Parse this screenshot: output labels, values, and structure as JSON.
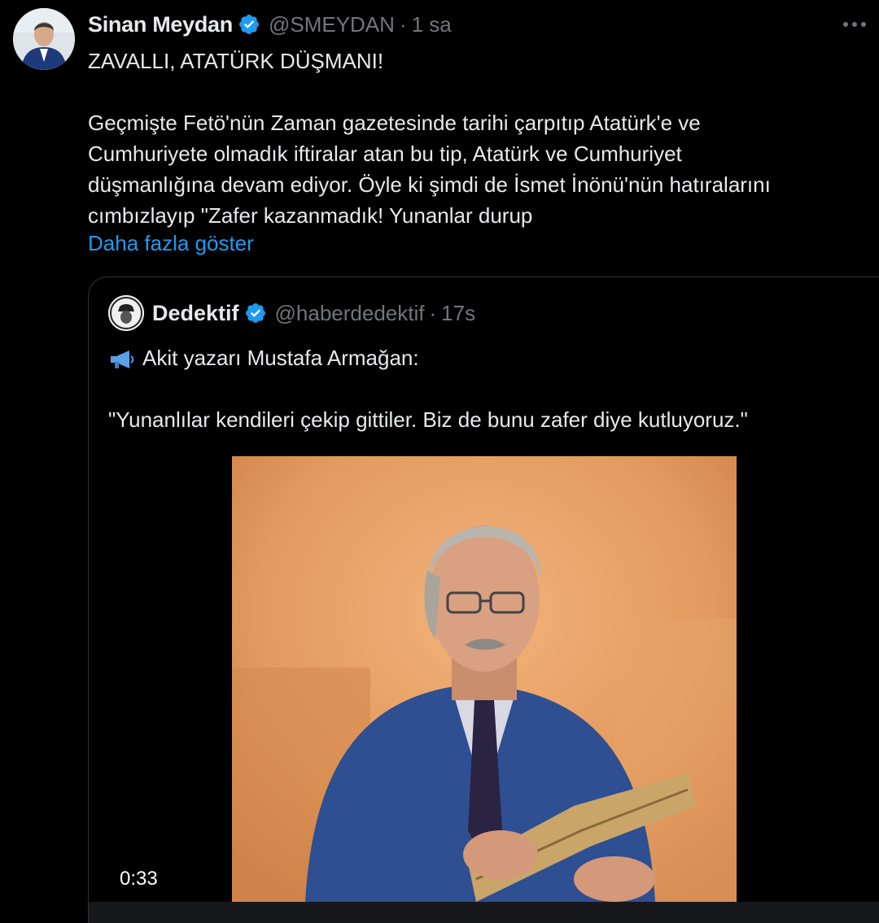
{
  "tweet": {
    "author_name": "Sinan Meydan",
    "handle": "@SMEYDAN",
    "separator": "·",
    "time": "1 sa",
    "title_line": "ZAVALLI, ATATÜRK DÜŞMANI!",
    "body_lines": [
      "Geçmişte Fetö'nün Zaman gazetesinde tarihi çarpıtıp Atatürk'e ve",
      "Cumhuriyete olmadık iftiralar atan bu tip, Atatürk ve Cumhuriyet",
      "düşmanlığına devam ediyor. Öyle ki şimdi de İsmet İnönü'nün hatıralarını",
      "cımbızlayıp \"Zafer kazanmadık! Yunanlar durup"
    ],
    "show_more": "Daha fazla göster"
  },
  "quote": {
    "author_name": "Dedektif",
    "handle": "@haberdedektif",
    "separator": "·",
    "time": "17s",
    "lead_line": "Akit yazarı Mustafa Armağan:",
    "quote_line": "\"Yunanlılar kendileri çekip gittiler. Biz de bunu zafer diye kutluyoruz.\"",
    "video_duration": "0:33"
  },
  "icons": {
    "verified": "verified-badge-icon",
    "more": "more-horizontal-icon",
    "megaphone": "megaphone-icon"
  },
  "colors": {
    "background": "#000000",
    "text_primary": "#e7e9ea",
    "text_secondary": "#71767b",
    "link": "#1d9bf0",
    "verified": "#1d9bf0",
    "border": "#2f3336"
  }
}
